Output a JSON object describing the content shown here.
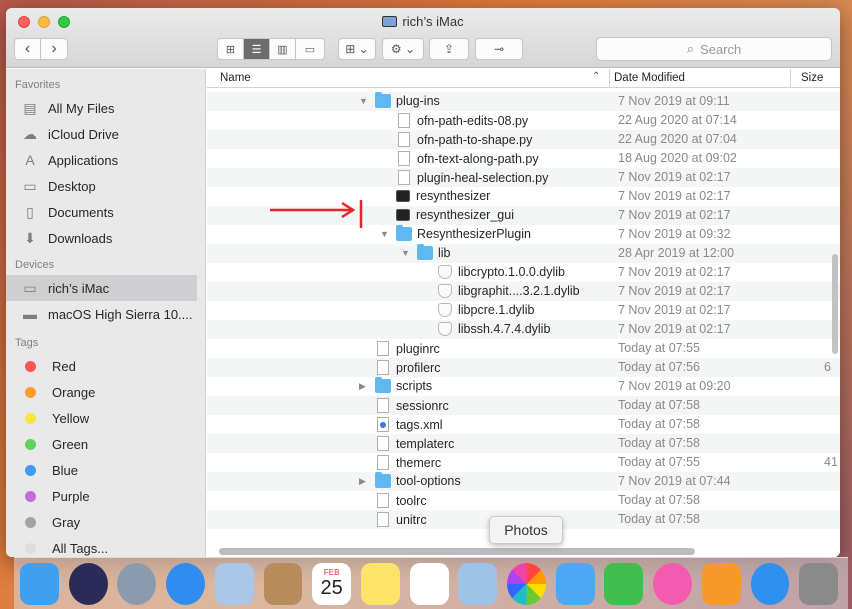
{
  "window": {
    "title": "rich’s iMac"
  },
  "toolbar": {
    "back": "‹",
    "forward": "›",
    "search_placeholder": "Search",
    "search_icon": "magnifier-icon"
  },
  "sidebar": {
    "favorites_header": "Favorites",
    "favorites": [
      {
        "label": "All My Files",
        "icon": "all-files-icon"
      },
      {
        "label": "iCloud Drive",
        "icon": "cloud-icon"
      },
      {
        "label": "Applications",
        "icon": "applications-icon"
      },
      {
        "label": "Desktop",
        "icon": "desktop-icon"
      },
      {
        "label": "Documents",
        "icon": "documents-icon"
      },
      {
        "label": "Downloads",
        "icon": "downloads-icon"
      }
    ],
    "devices_header": "Devices",
    "devices": [
      {
        "label": "rich’s iMac",
        "icon": "imac-icon",
        "selected": true
      },
      {
        "label": "macOS High Sierra 10....",
        "icon": "disk-icon"
      }
    ],
    "tags_header": "Tags",
    "tags": [
      {
        "label": "Red",
        "color": "#fc5753"
      },
      {
        "label": "Orange",
        "color": "#fd9a2a"
      },
      {
        "label": "Yellow",
        "color": "#fde43b"
      },
      {
        "label": "Green",
        "color": "#5fd35a"
      },
      {
        "label": "Blue",
        "color": "#3d9cf5"
      },
      {
        "label": "Purple",
        "color": "#c06cd9"
      },
      {
        "label": "Gray",
        "color": "#a3a3a3"
      },
      {
        "label": "All Tags...",
        "color": "#dedede"
      }
    ]
  },
  "columns": {
    "name": "Name",
    "date": "Date Modified",
    "size": "Size"
  },
  "files": [
    {
      "name": "plug-ins",
      "date": "7 Nov 2019 at 09:11",
      "size": "",
      "type": "folder",
      "level": 0,
      "disc": "open"
    },
    {
      "name": "ofn-path-edits-08.py",
      "date": "22 Aug 2020 at 07:14",
      "size": "",
      "type": "doc",
      "level": 1,
      "disc": ""
    },
    {
      "name": "ofn-path-to-shape.py",
      "date": "22 Aug 2020 at 07:04",
      "size": "",
      "type": "doc",
      "level": 1,
      "disc": ""
    },
    {
      "name": "ofn-text-along-path.py",
      "date": "18 Aug 2020 at 09:02",
      "size": "",
      "type": "doc",
      "level": 1,
      "disc": ""
    },
    {
      "name": "plugin-heal-selection.py",
      "date": "7 Nov 2019 at 02:17",
      "size": "",
      "type": "doc",
      "level": 1,
      "disc": ""
    },
    {
      "name": "resynthesizer",
      "date": "7 Nov 2019 at 02:17",
      "size": "",
      "type": "term",
      "level": 1,
      "disc": ""
    },
    {
      "name": "resynthesizer_gui",
      "date": "7 Nov 2019 at 02:17",
      "size": "",
      "type": "term",
      "level": 1,
      "disc": ""
    },
    {
      "name": "ResynthesizerPlugin",
      "date": "7 Nov 2019 at 09:32",
      "size": "",
      "type": "folder",
      "level": 1,
      "disc": "open"
    },
    {
      "name": "lib",
      "date": "28 Apr 2019 at 12:00",
      "size": "",
      "type": "folder",
      "level": 2,
      "disc": "open"
    },
    {
      "name": "libcrypto.1.0.0.dylib",
      "date": "7 Nov 2019 at 02:17",
      "size": "",
      "type": "lib",
      "level": 3,
      "disc": ""
    },
    {
      "name": "libgraphit....3.2.1.dylib",
      "date": "7 Nov 2019 at 02:17",
      "size": "",
      "type": "lib",
      "level": 3,
      "disc": ""
    },
    {
      "name": "libpcre.1.dylib",
      "date": "7 Nov 2019 at 02:17",
      "size": "",
      "type": "lib",
      "level": 3,
      "disc": ""
    },
    {
      "name": "libssh.4.7.4.dylib",
      "date": "7 Nov 2019 at 02:17",
      "size": "",
      "type": "lib",
      "level": 3,
      "disc": ""
    },
    {
      "name": "pluginrc",
      "date": "Today at 07:55",
      "size": "",
      "type": "doc",
      "level": 0,
      "disc": ""
    },
    {
      "name": "profilerc",
      "date": "Today at 07:56",
      "size": "6",
      "type": "doc",
      "level": 0,
      "disc": ""
    },
    {
      "name": "scripts",
      "date": "7 Nov 2019 at 09:20",
      "size": "",
      "type": "folder",
      "level": 0,
      "disc": "closed"
    },
    {
      "name": "sessionrc",
      "date": "Today at 07:58",
      "size": "",
      "type": "doc",
      "level": 0,
      "disc": ""
    },
    {
      "name": "tags.xml",
      "date": "Today at 07:58",
      "size": "",
      "type": "xml",
      "level": 0,
      "disc": ""
    },
    {
      "name": "templaterc",
      "date": "Today at 07:58",
      "size": "",
      "type": "doc",
      "level": 0,
      "disc": ""
    },
    {
      "name": "themerc",
      "date": "Today at 07:55",
      "size": "41",
      "type": "doc",
      "level": 0,
      "disc": ""
    },
    {
      "name": "tool-options",
      "date": "7 Nov 2019 at 07:44",
      "size": "",
      "type": "folder",
      "level": 0,
      "disc": "closed"
    },
    {
      "name": "toolrc",
      "date": "Today at 07:58",
      "size": "",
      "type": "doc",
      "level": 0,
      "disc": ""
    },
    {
      "name": "unitrc",
      "date": "Today at 07:58",
      "size": "",
      "type": "doc",
      "level": 0,
      "disc": ""
    }
  ],
  "tooltip": "Photos",
  "dock": {
    "calendar_month": "FEB",
    "calendar_day": "25",
    "apps": [
      {
        "name": "finder",
        "color": "#3fa0f2"
      },
      {
        "name": "siri",
        "color": "#2b2b57"
      },
      {
        "name": "launchpad",
        "color": "#8a9bb0"
      },
      {
        "name": "safari",
        "color": "#2f8df0"
      },
      {
        "name": "mail",
        "color": "#a9c6e6"
      },
      {
        "name": "contacts",
        "color": "#b88b5c"
      },
      {
        "name": "calendar",
        "color": "#ffffff"
      },
      {
        "name": "notes",
        "color": "#fde36a"
      },
      {
        "name": "reminders",
        "color": "#ffffff"
      },
      {
        "name": "preview",
        "color": "#9cc4e8"
      },
      {
        "name": "photos",
        "color": "#ffffff"
      },
      {
        "name": "messages",
        "color": "#4aa8f5"
      },
      {
        "name": "facetime",
        "color": "#3fbf4f"
      },
      {
        "name": "itunes",
        "color": "#f25bb0"
      },
      {
        "name": "ibooks",
        "color": "#f79a2b"
      },
      {
        "name": "app-store",
        "color": "#2e90ef"
      },
      {
        "name": "system-preferences",
        "color": "#8a8a8a"
      }
    ]
  }
}
